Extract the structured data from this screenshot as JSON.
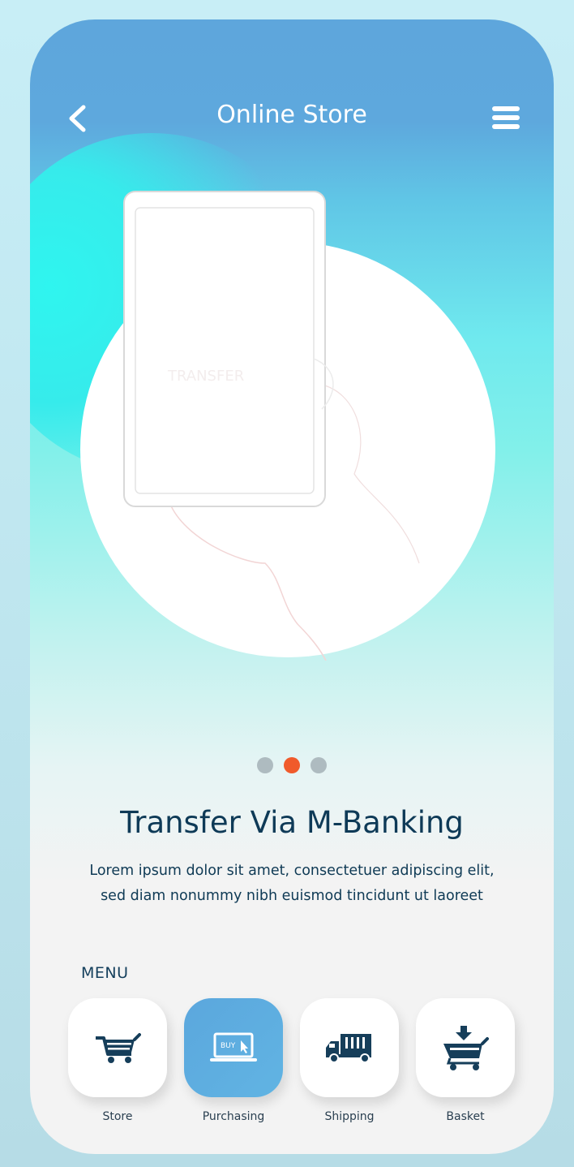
{
  "header": {
    "title": "Online Store",
    "back_icon": "chevron-left-icon",
    "menu_icon": "hamburger-menu-icon"
  },
  "carousel": {
    "pages": 3,
    "active_index": 1,
    "headline": "Transfer Via M-Banking",
    "description": "Lorem ipsum dolor sit amet, consectetuer adipiscing elit, sed diam nonummy nibh euismod tincidunt ut laoreet",
    "illustration": "hand-holding-phone-illustration"
  },
  "menu": {
    "label": "MENU",
    "items": [
      {
        "label": "Store",
        "icon": "shopping-cart-icon",
        "active": false
      },
      {
        "label": "Purchasing",
        "icon": "laptop-buy-icon",
        "active": true
      },
      {
        "label": "Shipping",
        "icon": "delivery-truck-icon",
        "active": false
      },
      {
        "label": "Basket",
        "icon": "basket-add-icon",
        "active": false
      }
    ]
  },
  "colors": {
    "accent": "#f05a2b",
    "primary_dark": "#0e3a57",
    "tile_active": "#5ba7dd",
    "dot_inactive": "#aebbc0"
  }
}
